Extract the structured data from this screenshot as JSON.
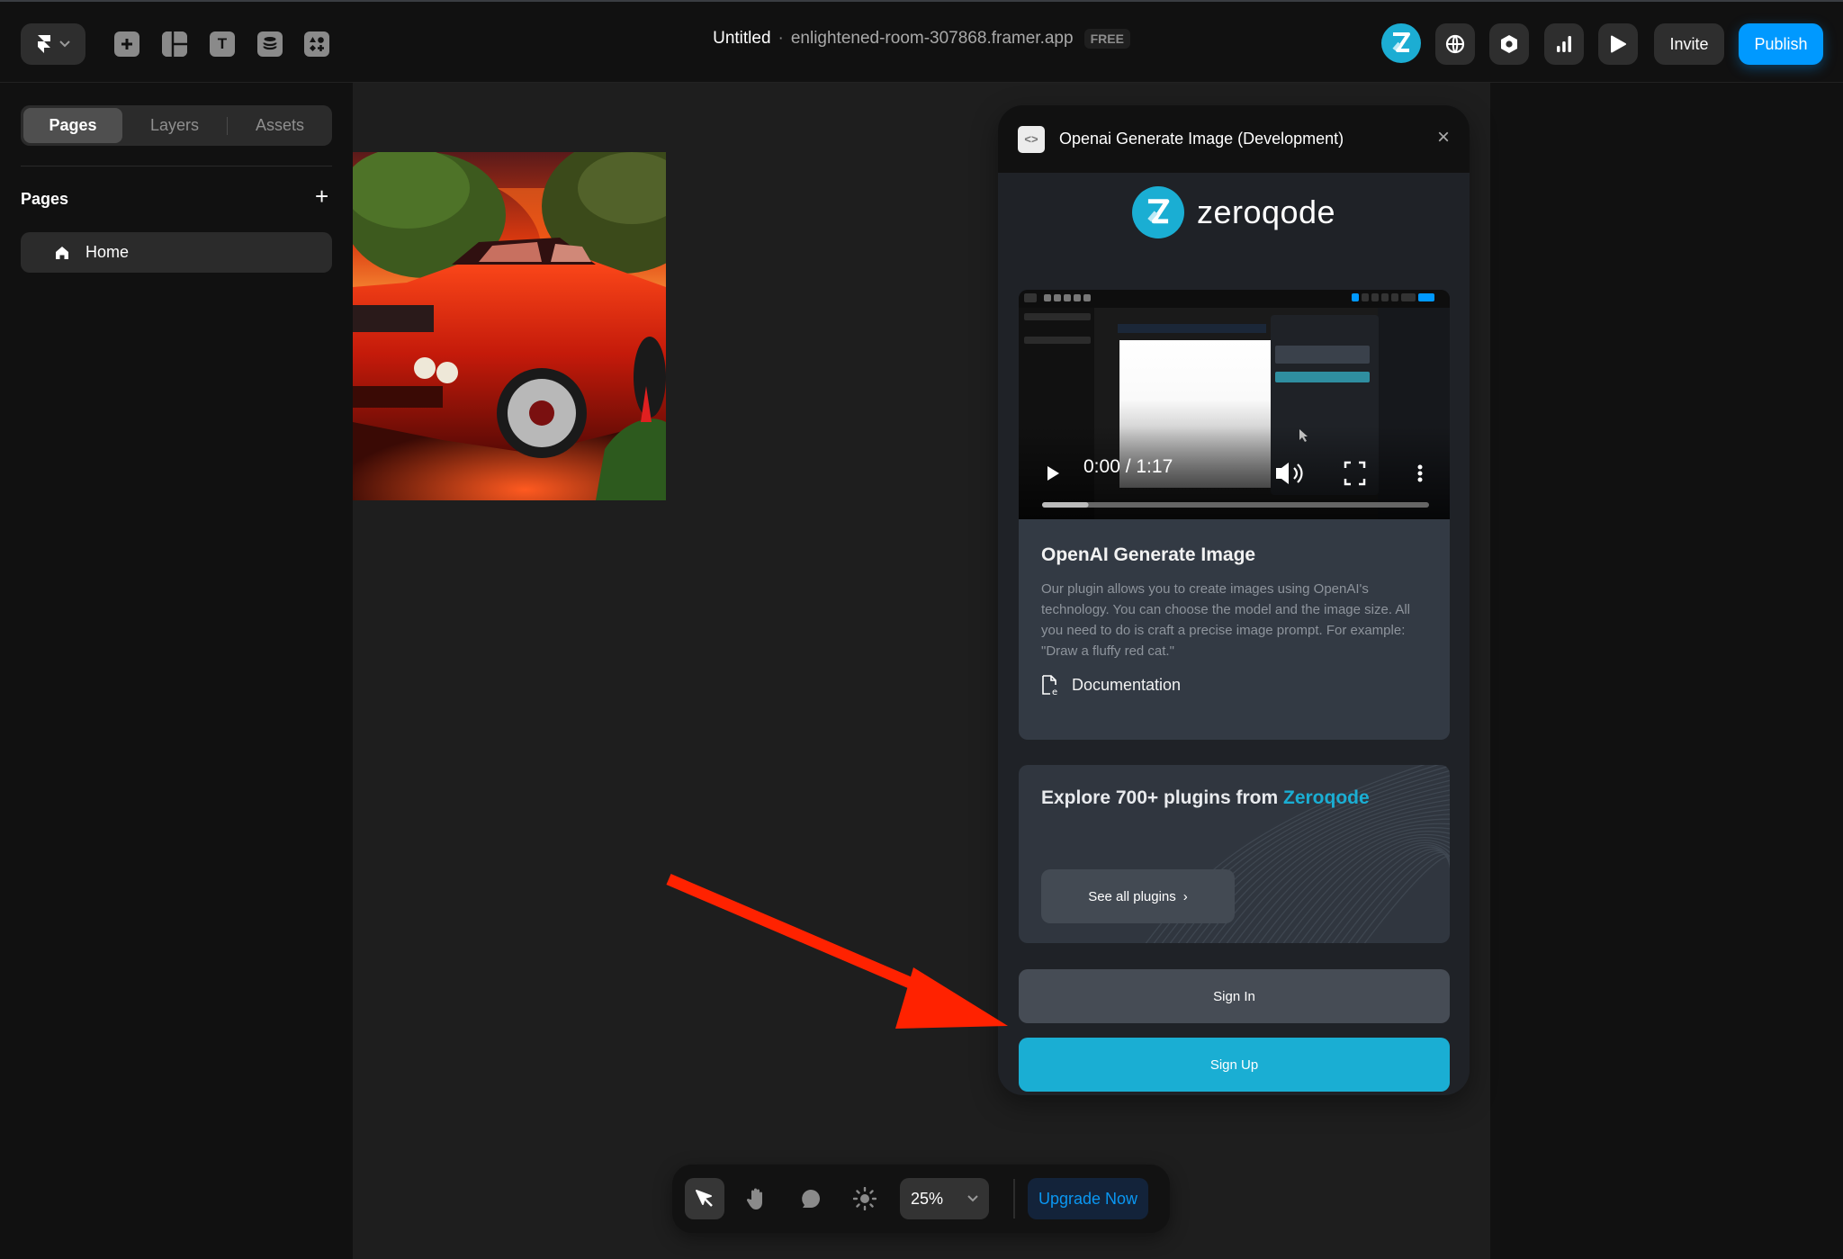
{
  "topbar": {
    "tools": [
      {
        "name": "insert",
        "icon": "plus-icon"
      },
      {
        "name": "layout",
        "icon": "layout-icon"
      },
      {
        "name": "text",
        "icon": "text-icon",
        "glyph": "T"
      },
      {
        "name": "cms",
        "icon": "database-icon"
      },
      {
        "name": "components",
        "icon": "shapes-icon"
      }
    ],
    "project_title": "Untitled",
    "separator": "·",
    "domain": "enlightened-room-307868.framer.app",
    "plan_badge": "FREE",
    "right": {
      "avatar_letter": "Z",
      "globe": "globe-icon",
      "settings": "hexagon-settings-icon",
      "analytics": "bar-chart-icon",
      "preview": "play-icon",
      "invite_label": "Invite",
      "publish_label": "Publish"
    }
  },
  "sidebar": {
    "tabs": [
      {
        "label": "Pages",
        "active": true
      },
      {
        "label": "Layers",
        "active": false
      },
      {
        "label": "Assets",
        "active": false
      }
    ],
    "section_title": "Pages",
    "add_label": "+",
    "pages": [
      {
        "label": "Home",
        "icon": "home-icon"
      }
    ]
  },
  "canvas": {
    "image_alt": "Red muscle car at sunset with trees"
  },
  "plugin": {
    "title": "Openai Generate Image (Development)",
    "code_glyph": "<>",
    "close_glyph": "×",
    "brand_name": "zeroqode",
    "video": {
      "time": "0:00 / 1:17",
      "progress_fraction": 0.12
    },
    "info": {
      "heading": "OpenAI Generate Image",
      "description": "Our plugin allows you to create images using OpenAI's technology. You can choose the model and the image size. All you need to do is craft a precise image prompt. For example: \"Draw a fluffy red cat.\"",
      "doc_link": "Documentation"
    },
    "explore": {
      "heading_prefix": "Explore 700+ plugins from ",
      "heading_accent": "Zeroqode",
      "button_label": "See all plugins",
      "button_chevron": "›"
    },
    "sign_in_label": "Sign In",
    "sign_up_label": "Sign Up"
  },
  "bottom_toolbar": {
    "zoom_level": "25%",
    "upgrade_label": "Upgrade Now"
  },
  "colors": {
    "accent_blue": "#0099ff",
    "zeroqode_teal": "#1aaed3",
    "annotation_red": "#ff2200"
  }
}
